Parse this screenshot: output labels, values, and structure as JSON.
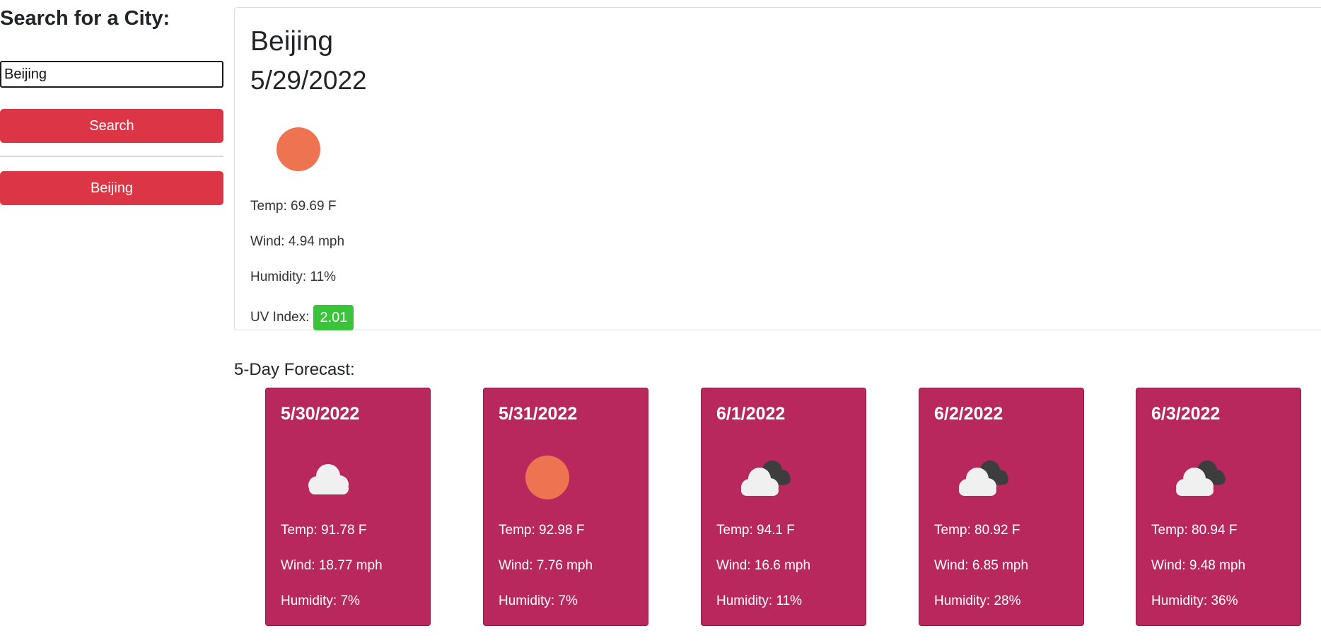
{
  "sidebar": {
    "heading": "Search for a City:",
    "search_value": "Beijing",
    "search_button": "Search",
    "history": [
      "Beijing"
    ]
  },
  "current": {
    "city": "Beijing",
    "date": "5/29/2022",
    "icon": "sun-icon",
    "temp": "Temp: 69.69 F",
    "wind": "Wind: 4.94 mph",
    "humidity": "Humidity: 11%",
    "uv_label": "UV Index:",
    "uv_value": "2.01",
    "uv_color": "#3ac43a"
  },
  "forecast": {
    "heading": "5-Day Forecast:",
    "card_color": "#b8285c",
    "days": [
      {
        "date": "5/30/2022",
        "icon": "cloud-icon",
        "temp": "Temp: 91.78 F",
        "wind": "Wind: 18.77 mph",
        "humidity": "Humidity: 7%"
      },
      {
        "date": "5/31/2022",
        "icon": "sun-icon",
        "temp": "Temp: 92.98 F",
        "wind": "Wind: 7.76 mph",
        "humidity": "Humidity: 7%"
      },
      {
        "date": "6/1/2022",
        "icon": "broken-clouds-icon",
        "temp": "Temp: 94.1 F",
        "wind": "Wind: 16.6 mph",
        "humidity": "Humidity: 11%"
      },
      {
        "date": "6/2/2022",
        "icon": "broken-clouds-icon",
        "temp": "Temp: 80.92 F",
        "wind": "Wind: 6.85 mph",
        "humidity": "Humidity: 28%"
      },
      {
        "date": "6/3/2022",
        "icon": "broken-clouds-icon",
        "temp": "Temp: 80.94 F",
        "wind": "Wind: 9.48 mph",
        "humidity": "Humidity: 36%"
      }
    ]
  },
  "colors": {
    "button": "#dc3545",
    "sun": "#ee7350",
    "cloud_light": "#f0f0f0",
    "cloud_dark": "#3d3d3d"
  }
}
